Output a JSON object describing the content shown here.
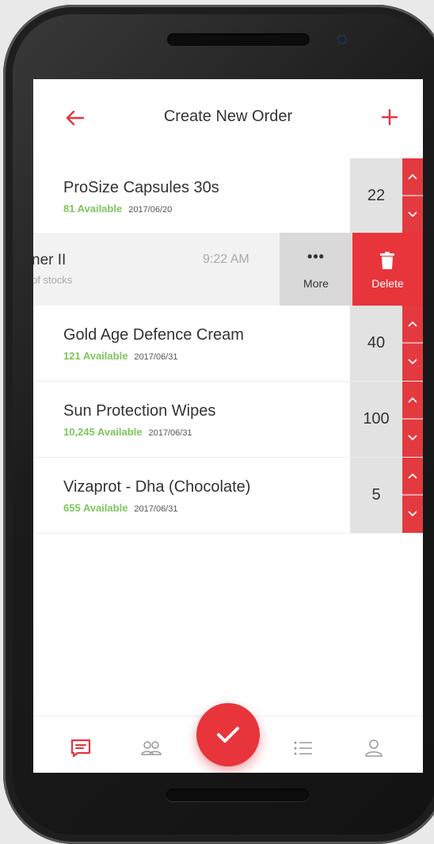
{
  "header": {
    "title": "Create New Order"
  },
  "products": [
    {
      "name": "ProSize Capsules 30s",
      "available": "81 Available",
      "date": "2017/06/20",
      "qty": "22"
    },
    {
      "name": "Gold Age Defence Cream",
      "available": "121 Available",
      "date": "2017/06/31",
      "qty": "40"
    },
    {
      "name": "Sun Protection Wipes",
      "available": "10,245 Available",
      "date": "2017/06/31",
      "qty": "100"
    },
    {
      "name": "Vizaprot - Dha (Chocolate)",
      "available": "655 Available",
      "date": "2017/06/31",
      "qty": "5"
    }
  ],
  "swiped_row": {
    "name": "ner II",
    "subtitle": "of stocks",
    "time": "9:22 AM",
    "more_icon": "•••",
    "more_label": "More",
    "delete_label": "Delete"
  },
  "icons": {
    "back": "arrow-left-icon",
    "add": "plus-icon",
    "more": "ellipsis-icon",
    "delete": "trash-icon",
    "nav": [
      "chat-icon",
      "group-icon",
      "checkmark-icon",
      "list-icon",
      "person-icon"
    ]
  },
  "colors": {
    "accent": "#e8343b",
    "available": "#7ec55c",
    "quantity_bg": "#e2e2e2"
  }
}
